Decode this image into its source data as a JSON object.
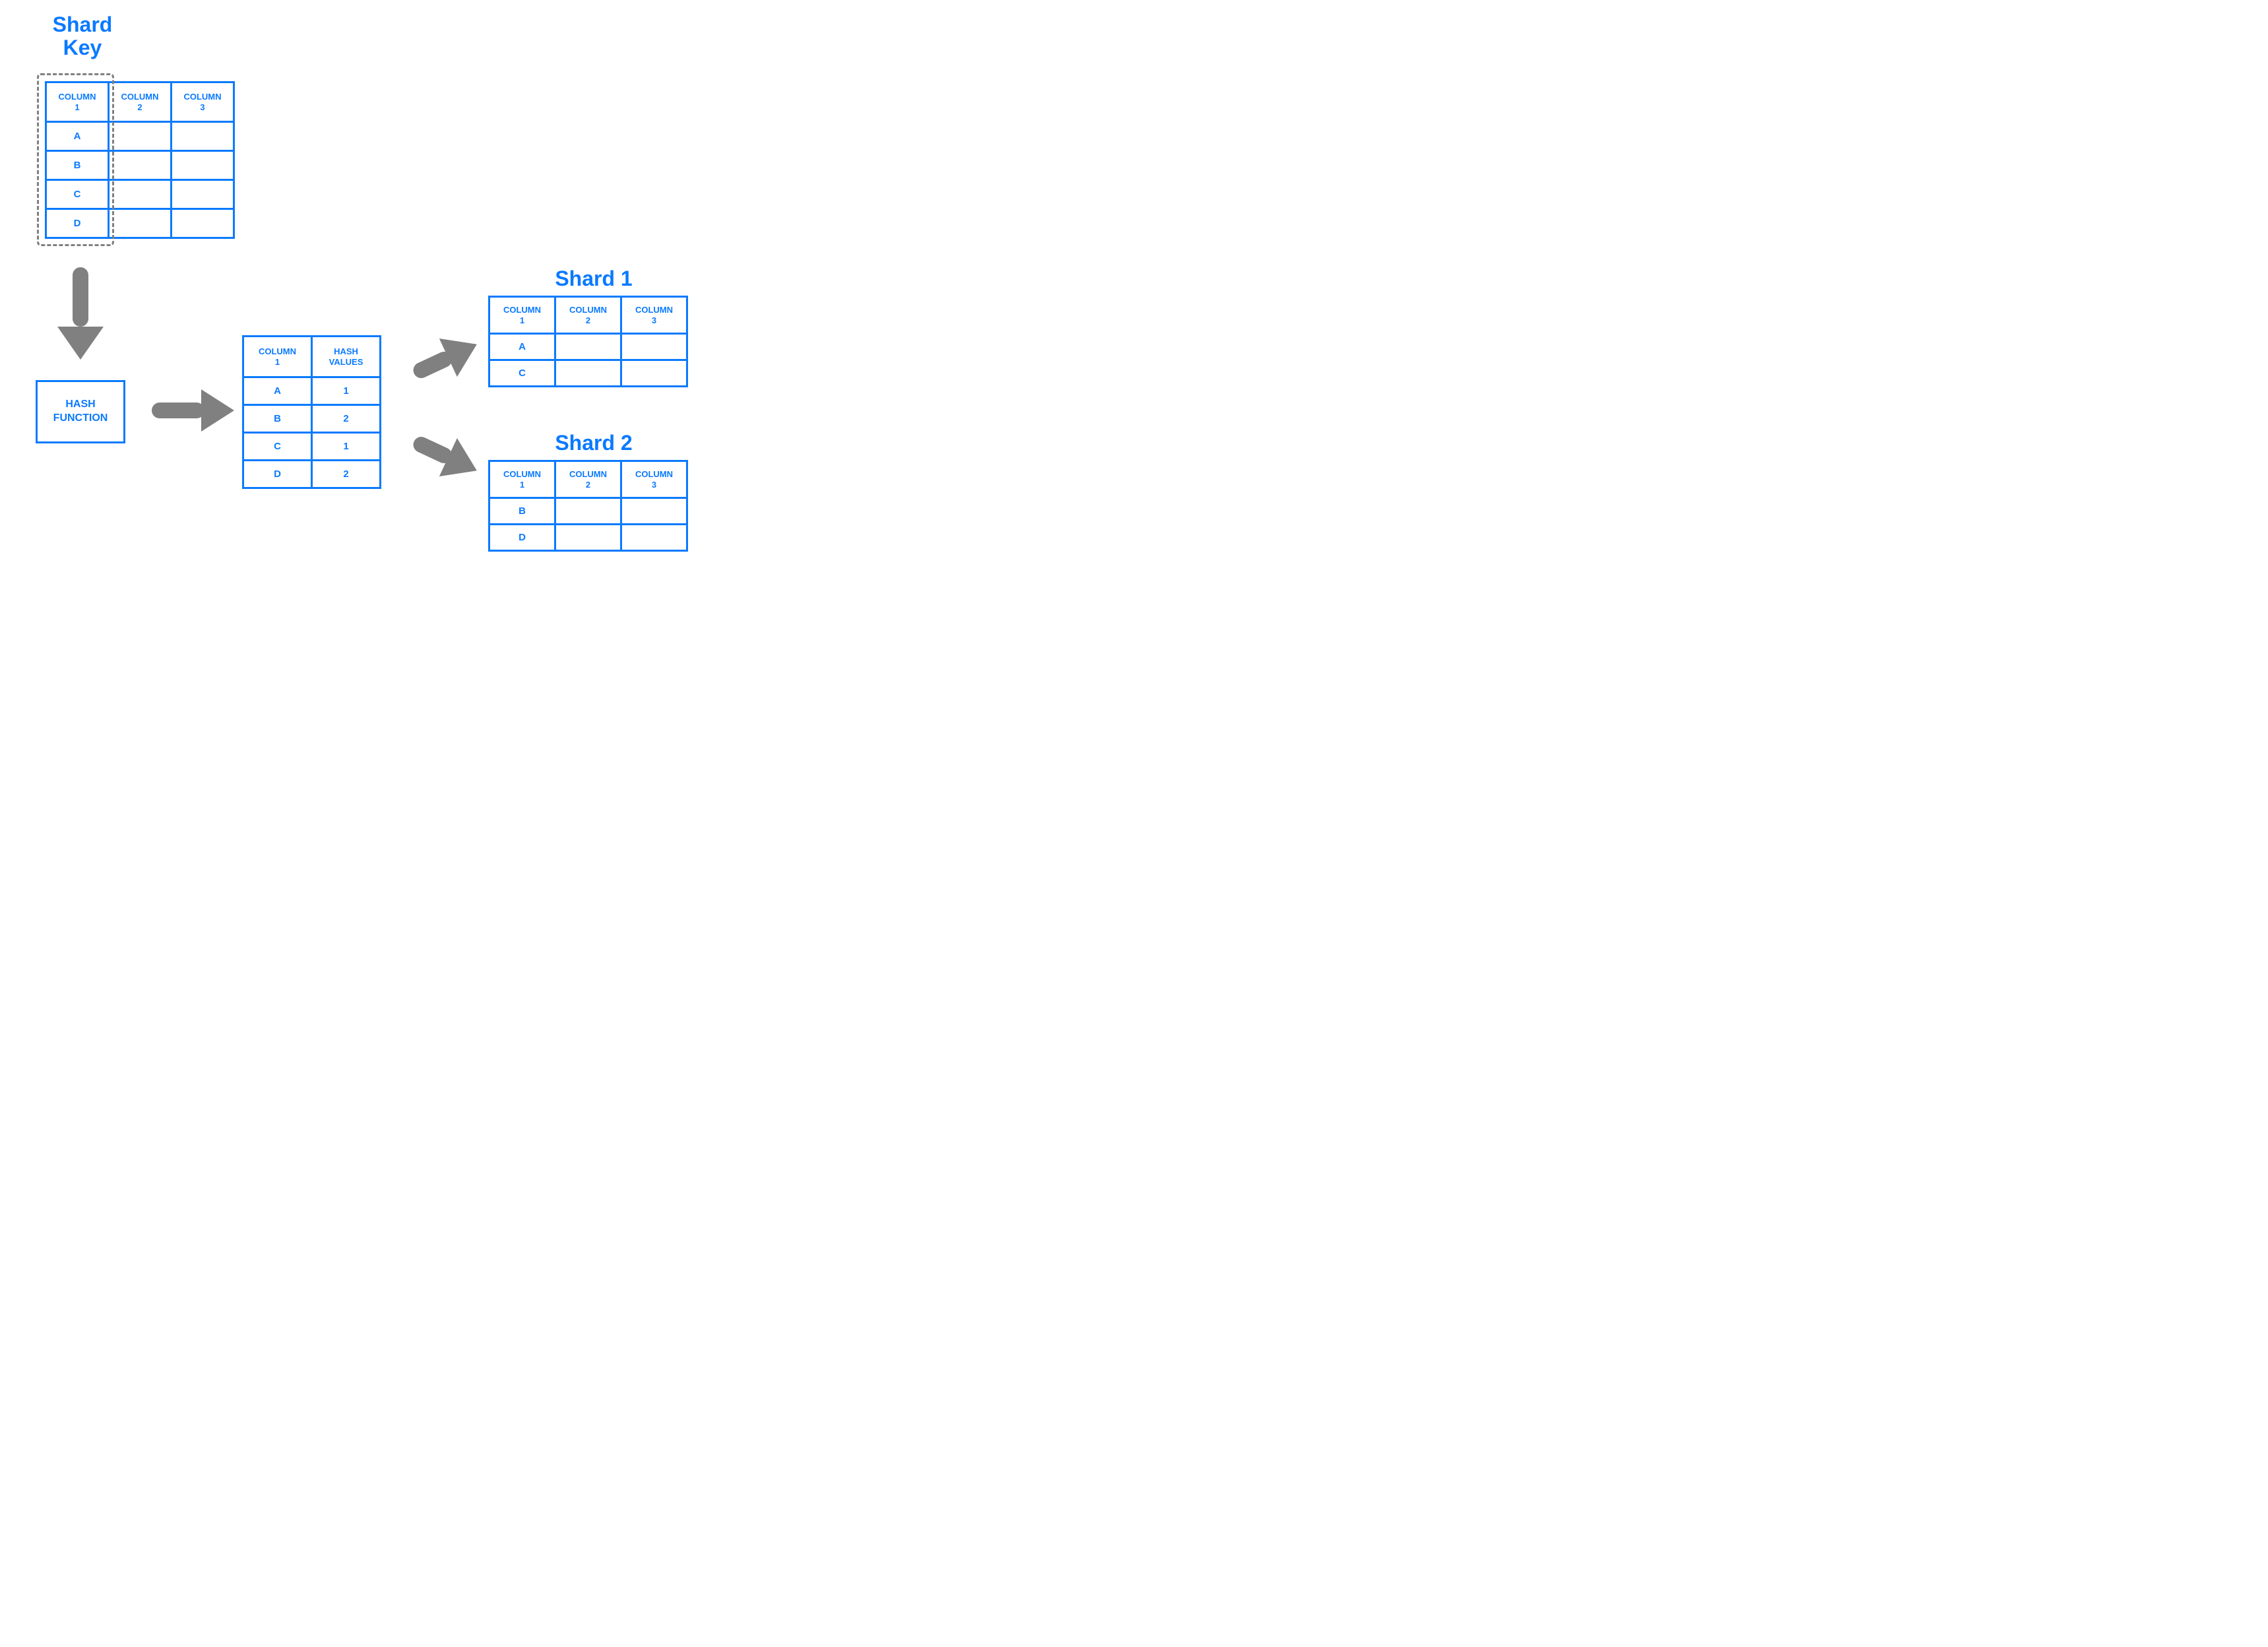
{
  "titles": {
    "shard_key": "Shard\nKey",
    "shard1": "Shard 1",
    "shard2": "Shard 2"
  },
  "source_table": {
    "headers": [
      "COLUMN\n1",
      "COLUMN\n2",
      "COLUMN\n3"
    ],
    "keys": [
      "A",
      "B",
      "C",
      "D"
    ]
  },
  "hash_function_label": "HASH\nFUNCTION",
  "hash_table": {
    "headers": [
      "COLUMN\n1",
      "HASH\nVALUES"
    ],
    "rows": [
      {
        "key": "A",
        "hash": "1"
      },
      {
        "key": "B",
        "hash": "2"
      },
      {
        "key": "C",
        "hash": "1"
      },
      {
        "key": "D",
        "hash": "2"
      }
    ]
  },
  "shard1": {
    "headers": [
      "COLUMN\n1",
      "COLUMN\n2",
      "COLUMN\n3"
    ],
    "keys": [
      "A",
      "C"
    ]
  },
  "shard2": {
    "headers": [
      "COLUMN\n1",
      "COLUMN\n2",
      "COLUMN\n3"
    ],
    "keys": [
      "B",
      "D"
    ]
  }
}
